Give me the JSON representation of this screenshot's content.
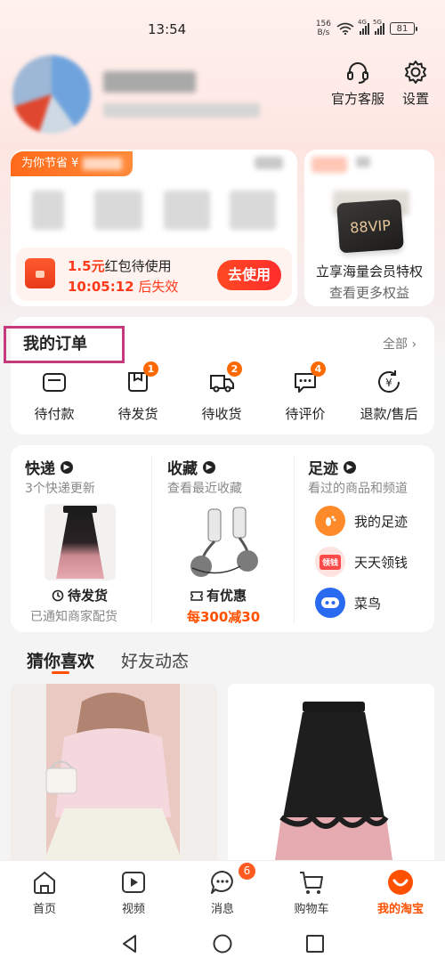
{
  "status_bar": {
    "time": "13:54",
    "net_speed_value": "156",
    "net_speed_unit": "B/s",
    "battery": "81",
    "signal1": "4G",
    "signal2": "5G"
  },
  "header": {
    "service_label": "官方客服",
    "settings_label": "设置"
  },
  "savings": {
    "tag": "为你节省 ¥",
    "redpacket_amount": "1.5元",
    "redpacket_text": "红包待使用",
    "countdown": "10:05:12",
    "countdown_suffix": "后失效",
    "use_button": "去使用"
  },
  "vip": {
    "card_text": "88VIP",
    "title": "立享海量会员特权",
    "subtitle": "查看更多权益"
  },
  "orders": {
    "title": "我的订单",
    "all_link": "全部 ›",
    "items": [
      {
        "label": "待付款",
        "icon": "wallet-icon",
        "badge": ""
      },
      {
        "label": "待发货",
        "icon": "package-icon",
        "badge": "1"
      },
      {
        "label": "待收货",
        "icon": "truck-icon",
        "badge": "2"
      },
      {
        "label": "待评价",
        "icon": "comment-icon",
        "badge": "4"
      },
      {
        "label": "退款/售后",
        "icon": "refund-icon",
        "badge": ""
      }
    ]
  },
  "express": {
    "title": "快递",
    "subtitle": "3个快递更新",
    "status": "待发货",
    "status_sub": "已通知商家配货"
  },
  "favorites": {
    "title": "收藏",
    "subtitle": "查看最近收藏",
    "status": "有优惠",
    "promo": "每300减30"
  },
  "footprints": {
    "title": "足迹",
    "subtitle": "看过的商品和频道",
    "items": [
      {
        "label": "我的足迹",
        "icon": "footprint-icon",
        "color": "#ff8a2a"
      },
      {
        "label": "天天领钱",
        "icon": "coupon-icon",
        "color": "#ff6a6a",
        "icon_text": "领钱"
      },
      {
        "label": "菜鸟",
        "icon": "cainiao-icon",
        "color": "#2a6af0"
      }
    ]
  },
  "feed_tabs": {
    "active": "猜你喜欢",
    "inactive": "好友动态"
  },
  "bottom_nav": {
    "items": [
      {
        "label": "首页",
        "icon": "home-icon"
      },
      {
        "label": "视频",
        "icon": "video-icon"
      },
      {
        "label": "消息",
        "icon": "message-icon",
        "badge": "6"
      },
      {
        "label": "购物车",
        "icon": "cart-icon"
      },
      {
        "label": "我的淘宝",
        "icon": "my-taobao-icon"
      }
    ]
  },
  "colors": {
    "accent": "#ff5000",
    "highlight_border": "#c43a7b",
    "badge": "#ff6a00"
  }
}
